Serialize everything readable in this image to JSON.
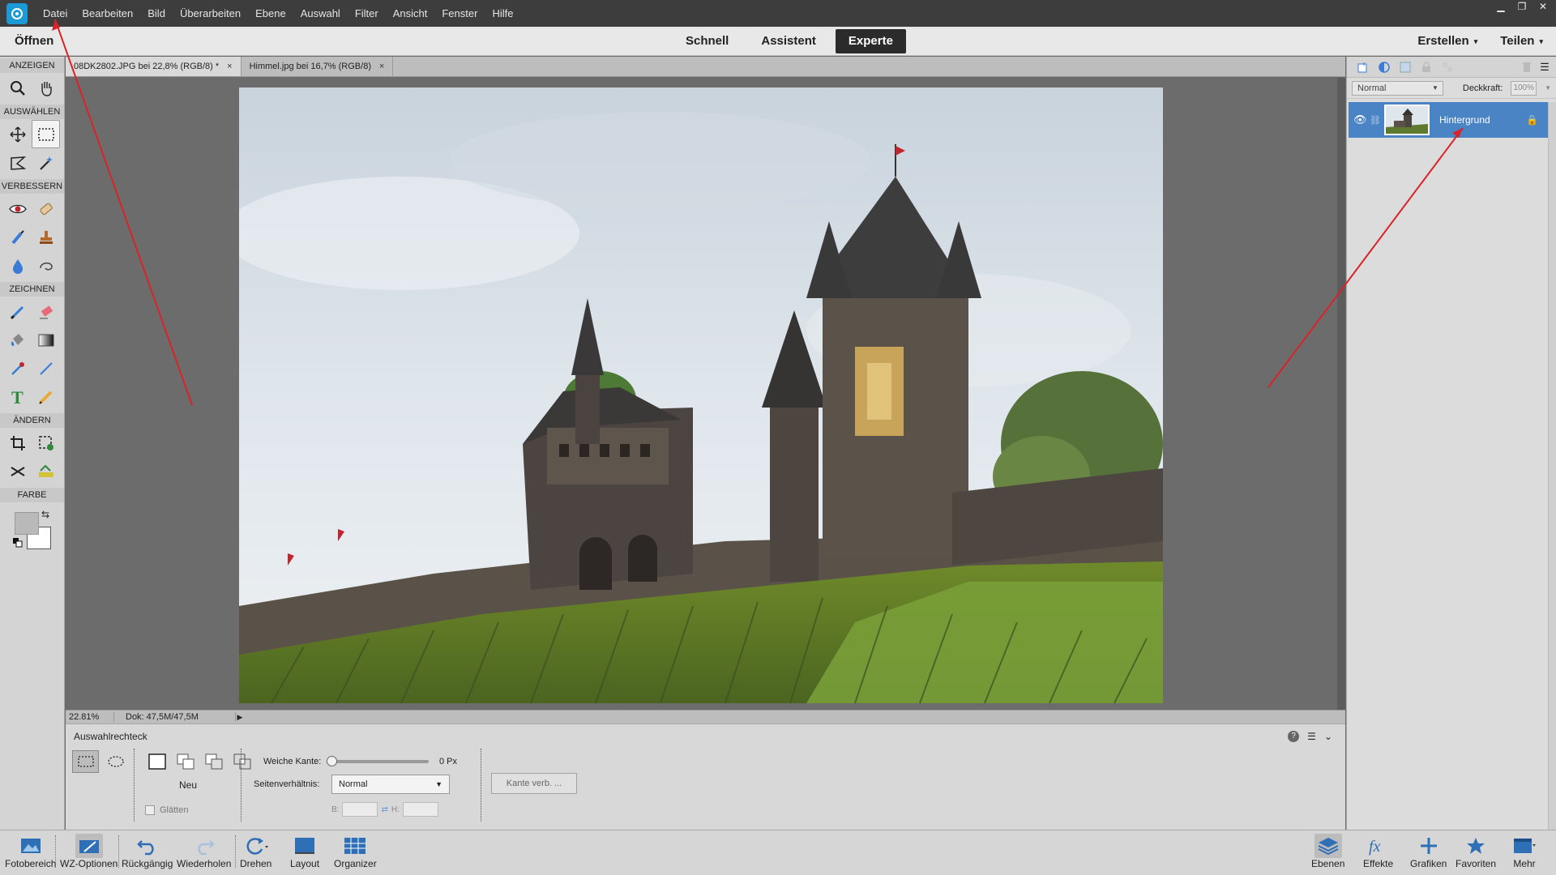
{
  "menubar": {
    "items": [
      "Datei",
      "Bearbeiten",
      "Bild",
      "Überarbeiten",
      "Ebene",
      "Auswahl",
      "Filter",
      "Ansicht",
      "Fenster",
      "Hilfe"
    ]
  },
  "modebar": {
    "open_label": "Öffnen",
    "tabs": [
      "Schnell",
      "Assistent",
      "Experte"
    ],
    "active_tab": "Experte",
    "create_label": "Erstellen",
    "share_label": "Teilen"
  },
  "toolbox": {
    "sections": {
      "view": "ANZEIGEN",
      "select": "AUSWÄHLEN",
      "enhance": "VERBESSERN",
      "draw": "ZEICHNEN",
      "modify": "ÄNDERN",
      "color": "FARBE"
    },
    "foreground_color": "#b9b9b9",
    "background_color": "#ffffff"
  },
  "documents": {
    "tabs": [
      {
        "label": "08DK2802.JPG bei 22,8% (RGB/8) *",
        "close": "×"
      },
      {
        "label": "Himmel.jpg bei 16,7% (RGB/8)",
        "close": "×"
      }
    ]
  },
  "status": {
    "zoom": "22.81%",
    "doc_size": "Dok: 47,5M/47,5M"
  },
  "options": {
    "tool_name": "Auswahlrechteck",
    "mode_label": "Neu",
    "smooth_label": "Glätten",
    "feather_label": "Weiche Kante:",
    "feather_value": "0 Px",
    "aspect_label": "Seitenverhältnis:",
    "aspect_value": "Normal",
    "w_label": "B:",
    "h_label": "H:",
    "refine_button": "Kante verb. ..."
  },
  "layers_panel": {
    "blend_mode": "Normal",
    "opacity_label": "Deckkraft:",
    "opacity_value": "100%",
    "layers": [
      {
        "name": "Hintergrund",
        "selected": true
      }
    ]
  },
  "bottombar": {
    "items": [
      {
        "label": "Fotobereich",
        "icon": "photo-bin-icon"
      },
      {
        "label": "WZ-Optionen",
        "icon": "tool-options-icon"
      },
      {
        "label": "Rückgängig",
        "icon": "undo-icon"
      },
      {
        "label": "Wiederholen",
        "icon": "redo-icon"
      },
      {
        "label": "Drehen",
        "icon": "rotate-icon"
      },
      {
        "label": "Layout",
        "icon": "layout-icon"
      },
      {
        "label": "Organizer",
        "icon": "organizer-icon"
      },
      {
        "label": "Ebenen",
        "icon": "layers-icon"
      },
      {
        "label": "Effekte",
        "icon": "fx-icon"
      },
      {
        "label": "Grafiken",
        "icon": "graphics-icon"
      },
      {
        "label": "Favoriten",
        "icon": "favorites-icon"
      },
      {
        "label": "Mehr",
        "icon": "more-icon"
      }
    ]
  },
  "colors": {
    "menubar_bg": "#3d3d3d",
    "canvas_bg": "#6c6c6c",
    "selected_layer": "#4a84c4",
    "accent_logo": "#1b9ad6",
    "annotation": "#d9232a"
  }
}
